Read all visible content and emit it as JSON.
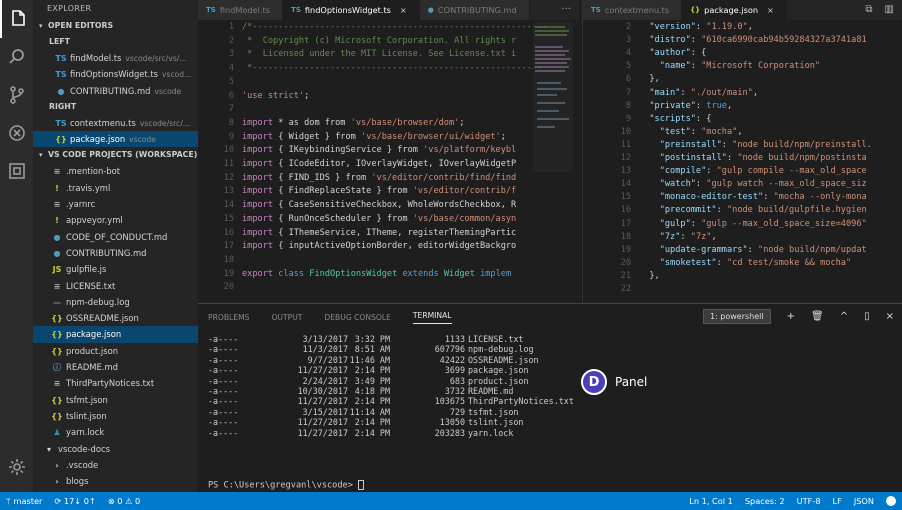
{
  "sidebar": {
    "title": "EXPLORER",
    "open_editors": {
      "label": "OPEN EDITORS",
      "left_label": "LEFT",
      "left_items": [
        {
          "icon": "TS",
          "icon_color": "#3c9fd6",
          "name": "findModel.ts",
          "desc": "vscode/src/vs/..."
        },
        {
          "icon": "TS",
          "icon_color": "#3c9fd6",
          "name": "findOptionsWidget.ts",
          "desc": "vscod..."
        },
        {
          "icon": "●",
          "icon_color": "#519aba",
          "name": "CONTRIBUTING.md",
          "desc": "vscode"
        }
      ],
      "right_label": "RIGHT",
      "right_items": [
        {
          "icon": "TS",
          "icon_color": "#3c9fd6",
          "name": "contextmenu.ts",
          "desc": "vscode/src/..."
        },
        {
          "icon": "{}",
          "icon_color": "#cbcb41",
          "name": "package.json",
          "desc": "vscode",
          "selected": true
        }
      ]
    },
    "project": {
      "label": "VS CODE PROJECTS (WORKSPACE)",
      "items": [
        {
          "icon": "≡",
          "icon_color": "#aaaaaa",
          "name": ".mention-bot"
        },
        {
          "icon": "!",
          "icon_color": "#cbcb41",
          "name": ".travis.yml"
        },
        {
          "icon": "≡",
          "icon_color": "#aaaaaa",
          "name": ".yarnrc"
        },
        {
          "icon": "!",
          "icon_color": "#cbcb41",
          "name": "appveyor.yml"
        },
        {
          "icon": "●",
          "icon_color": "#519aba",
          "name": "CODE_OF_CONDUCT.md"
        },
        {
          "icon": "●",
          "icon_color": "#519aba",
          "name": "CONTRIBUTING.md"
        },
        {
          "icon": "JS",
          "icon_color": "#cbcb41",
          "name": "gulpfile.js"
        },
        {
          "icon": "≡",
          "icon_color": "#aaaaaa",
          "name": "LICENSE.txt"
        },
        {
          "icon": "—",
          "icon_color": "#888888",
          "name": "npm-debug.log"
        },
        {
          "icon": "{}",
          "icon_color": "#cbcb41",
          "name": "OSSREADME.json"
        },
        {
          "icon": "{}",
          "icon_color": "#cbcb41",
          "name": "package.json",
          "selected": true
        },
        {
          "icon": "{}",
          "icon_color": "#cbcb41",
          "name": "product.json"
        },
        {
          "icon": "ⓘ",
          "icon_color": "#519aba",
          "name": "README.md"
        },
        {
          "icon": "≡",
          "icon_color": "#aaaaaa",
          "name": "ThirdPartyNotices.txt"
        },
        {
          "icon": "{}",
          "icon_color": "#cbcb41",
          "name": "tsfmt.json"
        },
        {
          "icon": "{}",
          "icon_color": "#cbcb41",
          "name": "tslint.json"
        },
        {
          "icon": "♟",
          "icon_color": "#2c8ebb",
          "name": "yarn.lock"
        }
      ]
    },
    "docs": {
      "label": "vscode-docs",
      "items": [
        {
          "icon": "›",
          "name": ".vscode"
        },
        {
          "icon": "›",
          "name": "blogs"
        }
      ]
    }
  },
  "editor_left": {
    "tabs": [
      {
        "icon": "TS",
        "label": "findModel.ts",
        "active": false
      },
      {
        "icon": "TS",
        "label": "findOptionsWidget.ts",
        "active": true,
        "close": "×"
      },
      {
        "icon": "●",
        "label": "CONTRIBUTING.md",
        "active": false
      }
    ],
    "more": "···",
    "line_numbers": [
      "1",
      "2",
      "3",
      "4",
      "5",
      "6",
      "7",
      "8",
      "9",
      "10",
      "11",
      "12",
      "13",
      "14",
      "15",
      "16",
      "17",
      "18",
      "19",
      "20"
    ],
    "lines": [
      [
        {
          "t": "/*---------------------------------------------------------",
          "c": "cm"
        }
      ],
      [
        {
          "t": " *  Copyright (c) Microsoft Corporation. All rights r",
          "c": "cm"
        }
      ],
      [
        {
          "t": " *  Licensed under the MIT License. See License.txt i",
          "c": "cm"
        }
      ],
      [
        {
          "t": " *--------------------------------------------------------",
          "c": "cm"
        }
      ],
      [],
      [
        {
          "t": "'use strict'",
          "c": "st"
        },
        {
          "t": ";",
          "c": ""
        }
      ],
      [],
      [
        {
          "t": "import",
          "c": "kw"
        },
        {
          "t": " * as dom from ",
          "c": ""
        },
        {
          "t": "'vs/base/browser/dom'",
          "c": "st"
        },
        {
          "t": ";",
          "c": ""
        }
      ],
      [
        {
          "t": "import",
          "c": "kw"
        },
        {
          "t": " { Widget } from ",
          "c": ""
        },
        {
          "t": "'vs/base/browser/ui/widget'",
          "c": "st"
        },
        {
          "t": ";",
          "c": ""
        }
      ],
      [
        {
          "t": "import",
          "c": "kw"
        },
        {
          "t": " { IKeybindingService } from ",
          "c": ""
        },
        {
          "t": "'vs/platform/keybl",
          "c": "st"
        }
      ],
      [
        {
          "t": "import",
          "c": "kw"
        },
        {
          "t": " { ICodeEditor, IOverlayWidget, IOverlayWidgetP",
          "c": ""
        }
      ],
      [
        {
          "t": "import",
          "c": "kw"
        },
        {
          "t": " { FIND_IDS } from ",
          "c": ""
        },
        {
          "t": "'vs/editor/contrib/find/find",
          "c": "st"
        }
      ],
      [
        {
          "t": "import",
          "c": "kw"
        },
        {
          "t": " { FindReplaceState } from ",
          "c": ""
        },
        {
          "t": "'vs/editor/contrib/f",
          "c": "st"
        }
      ],
      [
        {
          "t": "import",
          "c": "kw"
        },
        {
          "t": " { CaseSensitiveCheckbox, WholeWordsCheckbox, R",
          "c": ""
        }
      ],
      [
        {
          "t": "import",
          "c": "kw"
        },
        {
          "t": " { RunOnceScheduler } from ",
          "c": ""
        },
        {
          "t": "'vs/base/common/asyn",
          "c": "st"
        }
      ],
      [
        {
          "t": "import",
          "c": "kw"
        },
        {
          "t": " { IThemeService, ITheme, registerThemingPartic",
          "c": ""
        }
      ],
      [
        {
          "t": "import",
          "c": "kw"
        },
        {
          "t": " { inputActiveOptionBorder, editorWidgetBackgro",
          "c": ""
        }
      ],
      [],
      [
        {
          "t": "export",
          "c": "kw"
        },
        {
          "t": " ",
          "c": ""
        },
        {
          "t": "class",
          "c": "bl"
        },
        {
          "t": " ",
          "c": ""
        },
        {
          "t": "FindOptionsWidget",
          "c": "cl"
        },
        {
          "t": " ",
          "c": ""
        },
        {
          "t": "extends",
          "c": "bl"
        },
        {
          "t": " ",
          "c": ""
        },
        {
          "t": "Widget",
          "c": "cl"
        },
        {
          "t": " implem",
          "c": "bl"
        }
      ],
      []
    ]
  },
  "editor_right": {
    "tabs": [
      {
        "icon": "TS",
        "label": "contextmenu.ts",
        "active": false
      },
      {
        "icon": "{}",
        "label": "package.json",
        "active": true,
        "close": "×"
      }
    ],
    "line_numbers": [
      "2",
      "3",
      "4",
      "5",
      "6",
      "7",
      "8",
      "9",
      "10",
      "11",
      "12",
      "13",
      "14",
      "15",
      "16",
      "17",
      "18",
      "19",
      "20",
      "21",
      "22"
    ],
    "lines": [
      [
        {
          "t": "  \"version\"",
          "c": "pr"
        },
        {
          "t": ": ",
          "c": ""
        },
        {
          "t": "\"1.19.0\"",
          "c": "st"
        },
        {
          "t": ",",
          "c": ""
        }
      ],
      [
        {
          "t": "  \"distro\"",
          "c": "pr"
        },
        {
          "t": ": ",
          "c": ""
        },
        {
          "t": "\"610ca6990cab94b59284327a3741a81",
          "c": "st"
        }
      ],
      [
        {
          "t": "  \"author\"",
          "c": "pr"
        },
        {
          "t": ": {",
          "c": ""
        }
      ],
      [
        {
          "t": "    \"name\"",
          "c": "pr"
        },
        {
          "t": ": ",
          "c": ""
        },
        {
          "t": "\"Microsoft Corporation\"",
          "c": "st"
        }
      ],
      [
        {
          "t": "  },",
          "c": ""
        }
      ],
      [
        {
          "t": "  \"main\"",
          "c": "pr"
        },
        {
          "t": ": ",
          "c": ""
        },
        {
          "t": "\"./out/main\"",
          "c": "st"
        },
        {
          "t": ",",
          "c": ""
        }
      ],
      [
        {
          "t": "  \"private\"",
          "c": "pr"
        },
        {
          "t": ": ",
          "c": ""
        },
        {
          "t": "true",
          "c": "bl"
        },
        {
          "t": ",",
          "c": ""
        }
      ],
      [
        {
          "t": "  \"scripts\"",
          "c": "pr"
        },
        {
          "t": ": {",
          "c": ""
        }
      ],
      [
        {
          "t": "    \"test\"",
          "c": "pr"
        },
        {
          "t": ": ",
          "c": ""
        },
        {
          "t": "\"mocha\"",
          "c": "st"
        },
        {
          "t": ",",
          "c": ""
        }
      ],
      [
        {
          "t": "    \"preinstall\"",
          "c": "pr"
        },
        {
          "t": ": ",
          "c": ""
        },
        {
          "t": "\"node build/npm/preinstall.",
          "c": "st"
        }
      ],
      [
        {
          "t": "    \"postinstall\"",
          "c": "pr"
        },
        {
          "t": ": ",
          "c": ""
        },
        {
          "t": "\"node build/npm/postinsta",
          "c": "st"
        }
      ],
      [
        {
          "t": "    \"compile\"",
          "c": "pr"
        },
        {
          "t": ": ",
          "c": ""
        },
        {
          "t": "\"gulp compile --max_old_space",
          "c": "st"
        }
      ],
      [
        {
          "t": "    \"watch\"",
          "c": "pr"
        },
        {
          "t": ": ",
          "c": ""
        },
        {
          "t": "\"gulp watch --max_old_space_siz",
          "c": "st"
        }
      ],
      [
        {
          "t": "    \"monaco-editor-test\"",
          "c": "pr"
        },
        {
          "t": ": ",
          "c": ""
        },
        {
          "t": "\"mocha --only-mona",
          "c": "st"
        }
      ],
      [
        {
          "t": "    \"precommit\"",
          "c": "pr"
        },
        {
          "t": ": ",
          "c": ""
        },
        {
          "t": "\"node build/gulpfile.hygien",
          "c": "st"
        }
      ],
      [
        {
          "t": "    \"gulp\"",
          "c": "pr"
        },
        {
          "t": ": ",
          "c": ""
        },
        {
          "t": "\"gulp --max_old_space_size=4096\"",
          "c": "st"
        }
      ],
      [
        {
          "t": "    \"7z\"",
          "c": "pr"
        },
        {
          "t": ": ",
          "c": ""
        },
        {
          "t": "\"7z\"",
          "c": "st"
        },
        {
          "t": ",",
          "c": ""
        }
      ],
      [
        {
          "t": "    \"update-grammars\"",
          "c": "pr"
        },
        {
          "t": ": ",
          "c": ""
        },
        {
          "t": "\"node build/npm/updat",
          "c": "st"
        }
      ],
      [
        {
          "t": "    \"smoketest\"",
          "c": "pr"
        },
        {
          "t": ": ",
          "c": ""
        },
        {
          "t": "\"cd test/smoke && mocha\"",
          "c": "st"
        }
      ],
      [
        {
          "t": "  },",
          "c": ""
        }
      ],
      []
    ]
  },
  "panel": {
    "tabs": [
      "PROBLEMS",
      "OUTPUT",
      "DEBUG CONSOLE",
      "TERMINAL"
    ],
    "active_tab": "TERMINAL",
    "terminal_select": "1: powershell",
    "actions": [
      "+",
      "🗑",
      "^",
      "▯",
      "×"
    ],
    "rows": [
      {
        "mode": "-a----",
        "date": "3/13/2017",
        "time": "3:32 PM",
        "size": "1133",
        "name": "LICENSE.txt"
      },
      {
        "mode": "-a----",
        "date": "11/3/2017",
        "time": "8:51 AM",
        "size": "607796",
        "name": "npm-debug.log"
      },
      {
        "mode": "-a----",
        "date": "9/7/2017",
        "time": "11:46 AM",
        "size": "42422",
        "name": "OSSREADME.json"
      },
      {
        "mode": "-a----",
        "date": "11/27/2017",
        "time": "2:14 PM",
        "size": "3699",
        "name": "package.json"
      },
      {
        "mode": "-a----",
        "date": "2/24/2017",
        "time": "3:49 PM",
        "size": "683",
        "name": "product.json"
      },
      {
        "mode": "-a----",
        "date": "10/30/2017",
        "time": "4:18 PM",
        "size": "3732",
        "name": "README.md"
      },
      {
        "mode": "-a----",
        "date": "11/27/2017",
        "time": "2:14 PM",
        "size": "103675",
        "name": "ThirdPartyNotices.txt"
      },
      {
        "mode": "-a----",
        "date": "3/15/2017",
        "time": "11:14 AM",
        "size": "729",
        "name": "tsfmt.json"
      },
      {
        "mode": "-a----",
        "date": "11/27/2017",
        "time": "2:14 PM",
        "size": "13050",
        "name": "tslint.json"
      },
      {
        "mode": "-a----",
        "date": "11/27/2017",
        "time": "2:14 PM",
        "size": "203283",
        "name": "yarn.lock"
      }
    ],
    "prompt": "PS C:\\Users\\gregvanl\\vscode> "
  },
  "callout": {
    "letter": "D",
    "label": "Panel"
  },
  "status": {
    "branch": "ᛘ master",
    "sync": "⟳ 17↓ 0↑",
    "problems": "⊗ 0 ⚠ 0",
    "position": "Ln 1, Col 1",
    "spaces": "Spaces: 2",
    "encoding": "UTF-8",
    "eol": "LF",
    "language": "JSON"
  }
}
